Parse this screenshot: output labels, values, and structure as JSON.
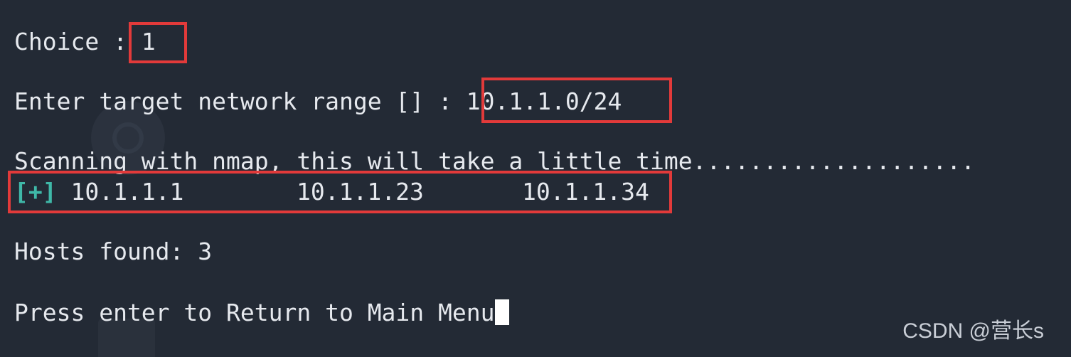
{
  "terminal": {
    "lines": {
      "choice_prompt": "Choice : ",
      "choice_value": "1",
      "range_prompt": "Enter target network range [] : ",
      "range_value": "10.1.1.0/24",
      "scanning": "Scanning with nmap, this will take a little time....................",
      "result_marker": "[+]",
      "hosts": [
        "10.1.1.1",
        "10.1.1.23",
        "10.1.1.34"
      ],
      "hosts_found": "Hosts found: 3",
      "return_prompt": "Press enter to Return to Main Menu"
    },
    "colors": {
      "background": "#232a35",
      "text": "#e6e9ee",
      "marker": "#3fb8a8",
      "highlight_box": "#e23a3a"
    }
  },
  "watermark": "CSDN @营长s"
}
